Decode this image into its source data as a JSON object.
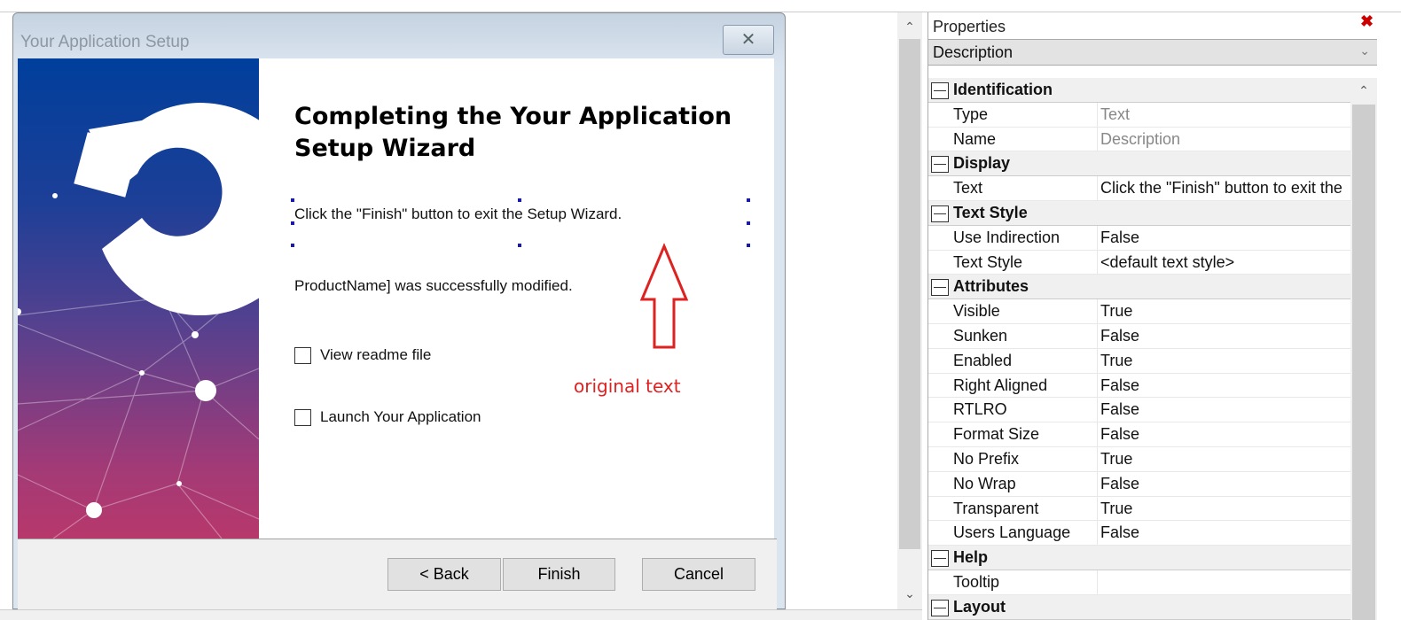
{
  "dialog": {
    "title": "Your Application Setup",
    "close_icon": "close-icon",
    "heading": "Completing the Your Application Setup Wizard",
    "description": "Click the \"Finish\" button to exit the Setup Wizard.",
    "status": "ProductName] was successfully modified.",
    "checkboxes": [
      {
        "label": "View readme file",
        "checked": false
      },
      {
        "label": "Launch Your Application",
        "checked": false
      }
    ],
    "buttons": {
      "back": "< Back",
      "finish": "Finish",
      "cancel": "Cancel"
    },
    "banner_colors": [
      "#003f9c",
      "#b7386b"
    ]
  },
  "annotation": {
    "text": "original text",
    "color": "#d22222"
  },
  "properties": {
    "title": "Properties",
    "selected": "Description",
    "rows": [
      {
        "cat": true,
        "name": "Identification"
      },
      {
        "name": "Type",
        "value": "Text",
        "gray": true
      },
      {
        "name": "Name",
        "value": "Description",
        "gray": true
      },
      {
        "cat": true,
        "name": "Display"
      },
      {
        "name": "Text",
        "value": "Click the \"Finish\" button to exit the"
      },
      {
        "cat": true,
        "name": "Text Style"
      },
      {
        "name": "Use Indirection",
        "value": "False"
      },
      {
        "name": "Text Style",
        "value": "<default text style>"
      },
      {
        "cat": true,
        "name": "Attributes"
      },
      {
        "name": "Visible",
        "value": "True"
      },
      {
        "name": "Sunken",
        "value": "False"
      },
      {
        "name": "Enabled",
        "value": "True"
      },
      {
        "name": "Right Aligned",
        "value": "False"
      },
      {
        "name": "RTLRO",
        "value": "False"
      },
      {
        "name": "Format Size",
        "value": "False"
      },
      {
        "name": "No Prefix",
        "value": "True"
      },
      {
        "name": "No Wrap",
        "value": "False"
      },
      {
        "name": "Transparent",
        "value": "True"
      },
      {
        "name": "Users Language",
        "value": "False"
      },
      {
        "cat": true,
        "name": "Help"
      },
      {
        "name": "Tooltip",
        "value": ""
      },
      {
        "cat": true,
        "name": "Layout"
      }
    ]
  }
}
